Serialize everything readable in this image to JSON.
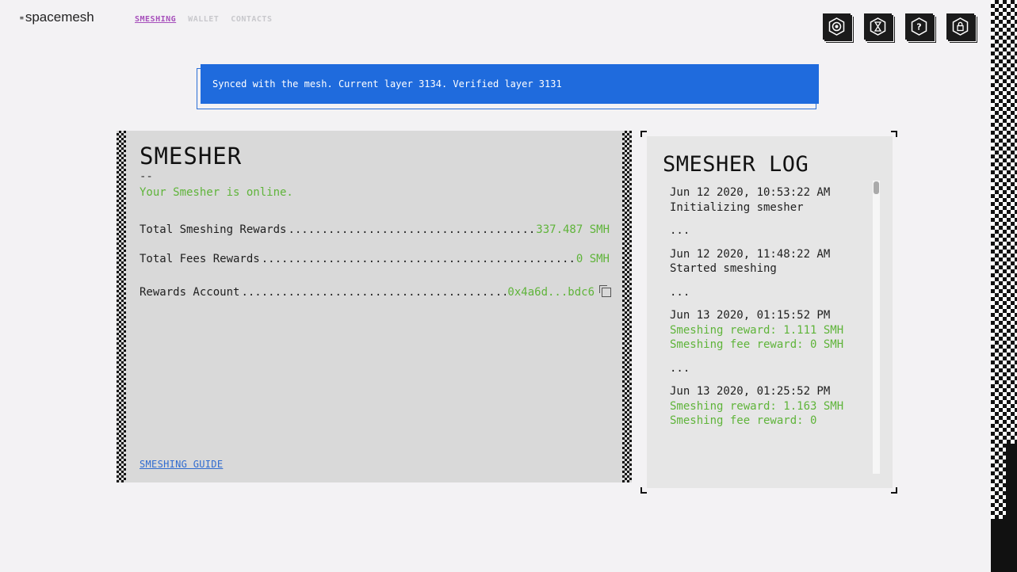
{
  "logo": {
    "mark": "≡",
    "text": "spacemesh"
  },
  "nav": {
    "items": [
      "SMESHING",
      "WALLET",
      "CONTACTS"
    ],
    "active": "SMESHING"
  },
  "top_icons": [
    "settings-icon",
    "hourglass-icon",
    "help-icon",
    "lock-icon"
  ],
  "banner": {
    "text": "Synced with the mesh. Current layer 3134. Verified layer 3131"
  },
  "smesher": {
    "title": "SMESHER",
    "dash": "--",
    "status": "Your Smesher is online.",
    "rows": [
      {
        "label": "Total Smeshing Rewards",
        "value": "337.487 SMH"
      },
      {
        "label": "Total Fees Rewards",
        "value": "0 SMH"
      },
      {
        "label": "Rewards Account",
        "value": "0x4a6d...bdc6"
      }
    ],
    "guide": "SMESHING GUIDE"
  },
  "log": {
    "title": "SMESHER LOG",
    "separator": "...",
    "entries": [
      {
        "time": "Jun 12 2020, 10:53:22 AM",
        "lines": [
          "Initializing smesher"
        ],
        "green": []
      },
      {
        "time": "Jun 12 2020, 11:48:22 AM",
        "lines": [
          "Started smeshing"
        ],
        "green": []
      },
      {
        "time": "Jun 13 2020, 01:15:52 PM",
        "lines": [],
        "green": [
          "Smeshing reward: 1.111 SMH",
          "Smeshing fee reward: 0 SMH"
        ]
      },
      {
        "time": "Jun 13 2020, 01:25:52 PM",
        "lines": [],
        "green": [
          "Smeshing reward: 1.163 SMH",
          "Smeshing fee reward: 0"
        ]
      }
    ]
  },
  "colors": {
    "accent": "#a64fbb",
    "banner": "#1f6bdd",
    "green": "#5fb43a",
    "link": "#2f6bd0"
  }
}
